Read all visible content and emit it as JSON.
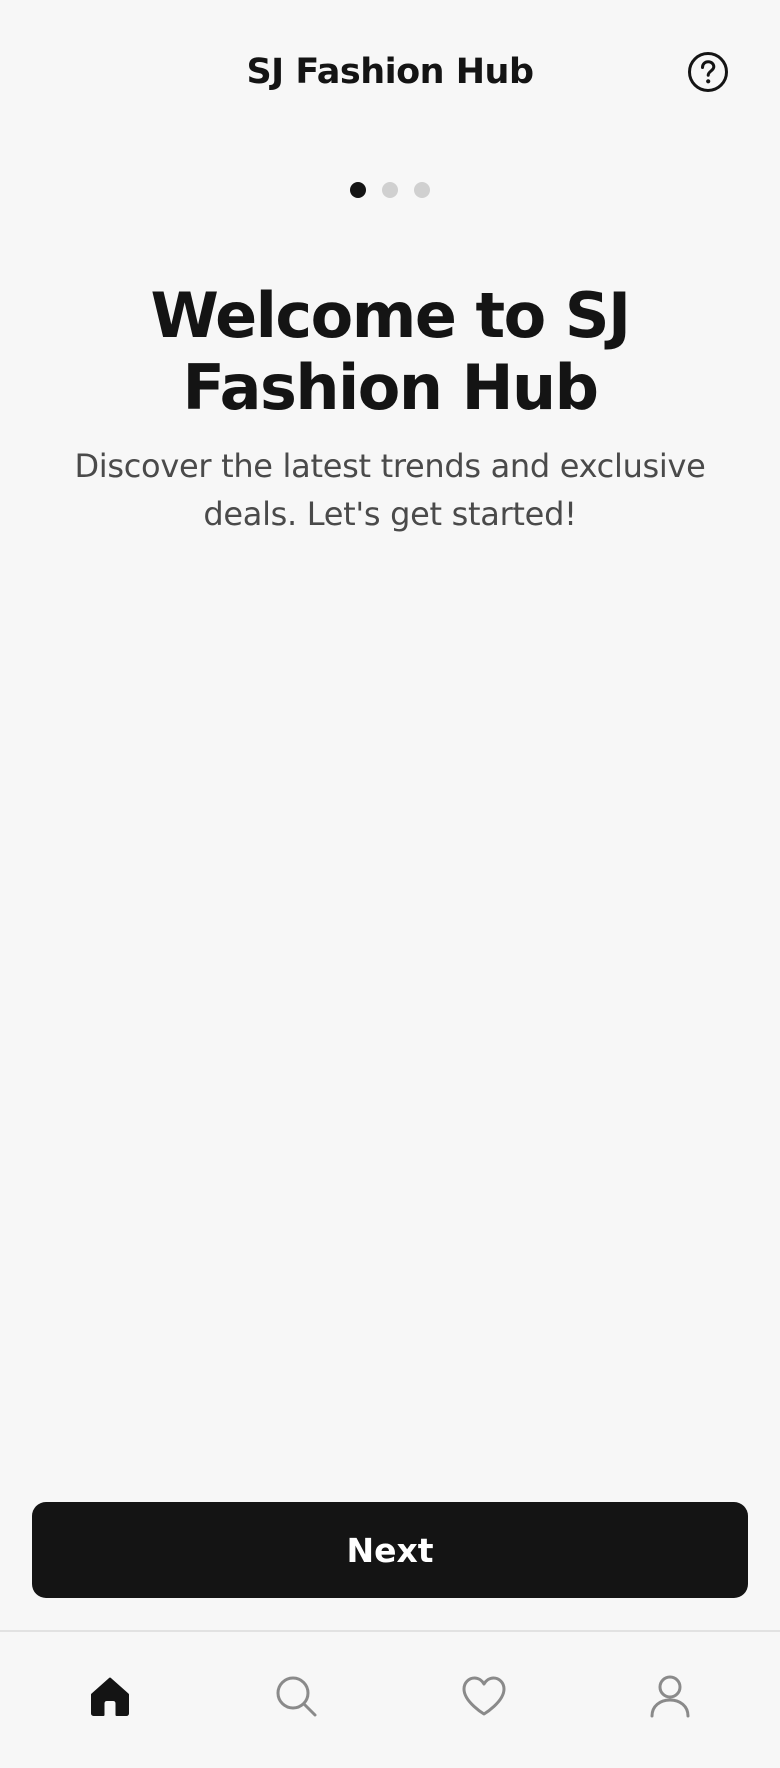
{
  "header": {
    "title": "SJ Fashion Hub",
    "help_icon": "help-circle-icon"
  },
  "pagination": {
    "total": 3,
    "active_index": 0
  },
  "hero": {
    "title": "Welcome to SJ Fashion Hub",
    "subtitle": "Discover the latest trends and exclusive deals. Let's get started!"
  },
  "actions": {
    "next_label": "Next"
  },
  "bottom_nav": {
    "items": [
      {
        "icon": "home-icon",
        "active": true
      },
      {
        "icon": "search-icon",
        "active": false
      },
      {
        "icon": "heart-icon",
        "active": false
      },
      {
        "icon": "user-icon",
        "active": false
      }
    ]
  },
  "colors": {
    "background": "#f7f7f7",
    "primary": "#141414",
    "inactive_dot": "#d0d0d0",
    "inactive_icon": "#8a8a8a",
    "subtitle_text": "#4a4a4a"
  }
}
